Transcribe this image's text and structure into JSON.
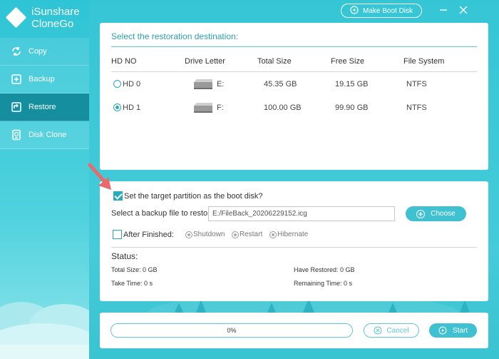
{
  "app": {
    "name_line1": "iSunshare",
    "name_line2": "CloneGo",
    "make_boot_disk": "Make Boot Disk"
  },
  "sidebar": {
    "items": [
      {
        "label": "Copy",
        "icon": "refresh-icon"
      },
      {
        "label": "Backup",
        "icon": "backup-icon"
      },
      {
        "label": "Restore",
        "icon": "restore-icon",
        "active": true
      },
      {
        "label": "Disk Clone",
        "icon": "disk-clone-icon"
      }
    ]
  },
  "destination": {
    "title": "Select the restoration destination:",
    "columns": [
      "HD NO",
      "Drive Letter",
      "Total Size",
      "Free Size",
      "File System"
    ],
    "rows": [
      {
        "hd": "HD 0",
        "letter": "E:",
        "total": "45.35 GB",
        "free": "19.15 GB",
        "fs": "NTFS",
        "selected": false
      },
      {
        "hd": "HD 1",
        "letter": "F:",
        "total": "100.00 GB",
        "free": "99.90 GB",
        "fs": "NTFS",
        "selected": true
      }
    ]
  },
  "options": {
    "boot_disk_label": "Set the target partition as the boot disk?",
    "boot_disk_checked": true,
    "backup_file_label": "Select a backup file to restore:",
    "backup_file_value": "E:/FileBack_20206229152.icg",
    "choose_label": "Choose",
    "after_finished_label": "After Finished:",
    "after_finished_checked": false,
    "after_options": [
      "Shutdown",
      "Restart",
      "Hibernate"
    ]
  },
  "status": {
    "title": "Status:",
    "total_size": "Total Size: 0 GB",
    "have_restored": "Have Restored: 0 GB",
    "take_time": "Take Time: 0 s",
    "remaining_time": "Remaining Time: 0 s"
  },
  "footer": {
    "progress_text": "0%",
    "progress_value": 0,
    "cancel_label": "Cancel",
    "start_label": "Start"
  },
  "colors": {
    "accent": "#3fc1d2",
    "sidebar_active": "#158fa0",
    "arrow": "#e86a6a"
  }
}
